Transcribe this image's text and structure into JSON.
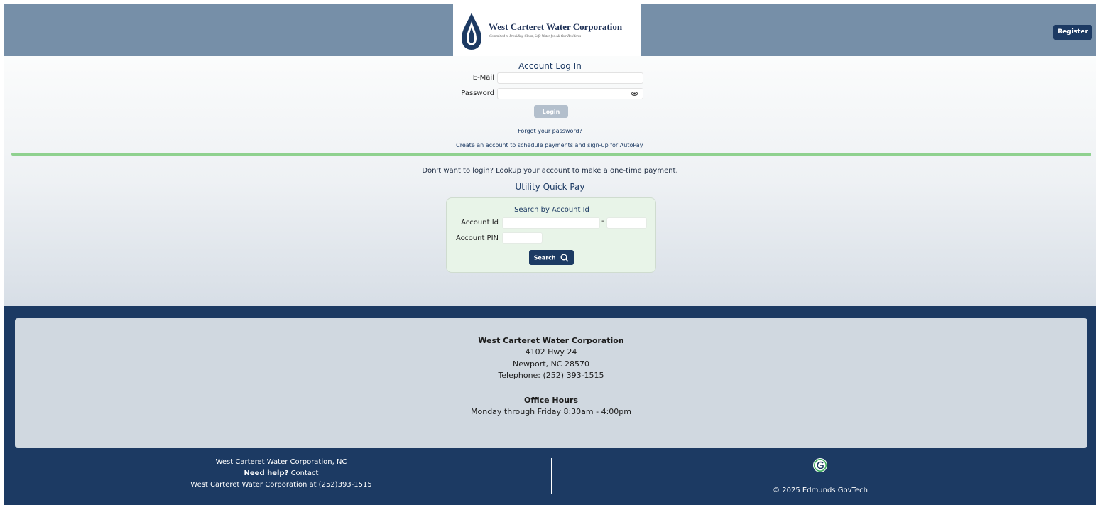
{
  "header": {
    "org_name": "West Carteret Water Corporation",
    "tagline": "Committed to Providing Clean, Safe Water for All Our Residents",
    "register_label": "Register"
  },
  "login": {
    "title": "Account Log In",
    "email_label": "E-Mail",
    "email_value": "",
    "password_label": "Password",
    "password_value": "",
    "login_label": "Login",
    "forgot_link": "Forgot your password?",
    "create_link": "Create an account to schedule payments and sign-up for AutoPay."
  },
  "quickpay": {
    "intro": "Don't want to login? Lookup your account to make a one-time payment.",
    "title": "Utility Quick Pay",
    "search_title": "Search by Account Id",
    "account_id_label": "Account Id",
    "account_id_value": "",
    "account_id_sep": "-",
    "account_id_suffix_value": "",
    "pin_label": "Account PIN",
    "pin_value": "",
    "search_label": "Search"
  },
  "footer": {
    "org_name": "West Carteret Water Corporation",
    "address1": "4102 Hwy 24",
    "address2": "Newport, NC 28570",
    "telephone": "Telephone: (252) 393-1515",
    "hours_title": "Office Hours",
    "hours": "Monday through Friday 8:30am - 4:00pm",
    "bottom_org": "West Carteret Water Corporation, NC",
    "need_help": "Need help?",
    "contact": " Contact",
    "contact_line": "West Carteret Water Corporation at (252)393-1515",
    "copyright": "© 2025 Edmunds GovTech"
  },
  "colors": {
    "header_bg": "#768fa8",
    "navy": "#1c3a63",
    "divider_green": "#8fd18f",
    "search_panel": "#e8f4e8",
    "login_disabled": "#b3bfcc"
  },
  "icons": [
    "water-drop-logo-icon",
    "eye-icon",
    "search-icon",
    "edmunds-logo-icon"
  ]
}
